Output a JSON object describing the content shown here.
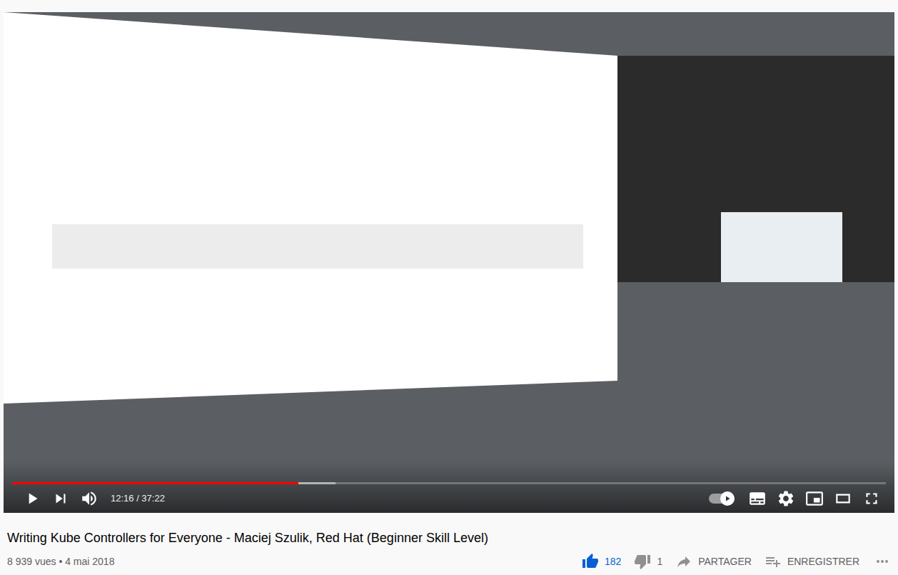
{
  "player": {
    "playing": false,
    "progress": {
      "level": 0.328,
      "buffered": 0.37
    },
    "time": "12:16 / 37:22",
    "autoplay": {
      "on": true
    }
  },
  "video": {
    "title": "Writing Kube Controllers for Everyone - Maciej Szulik, Red Hat (Beginner Skill Level)",
    "meta": "8 939 vues • 4 mai 2018"
  },
  "actions": [
    {
      "kind": "like",
      "label": "182",
      "selected": true
    },
    {
      "kind": "dislike",
      "label": "1",
      "selected": false
    },
    {
      "kind": "share",
      "label": "PARTAGER"
    },
    {
      "kind": "save",
      "label": "ENREGISTRER"
    }
  ]
}
